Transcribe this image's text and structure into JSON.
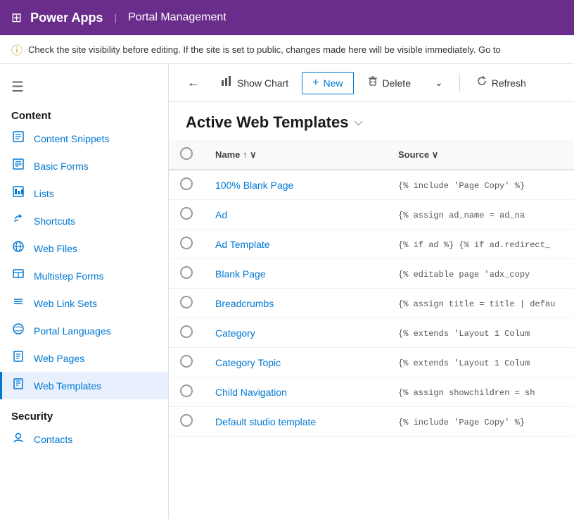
{
  "header": {
    "app_title": "Power Apps",
    "portal_title": "Portal Management",
    "grid_icon": "⊞"
  },
  "warning": {
    "text": "Check the site visibility before editing. If the site is set to public, changes made here will be visible immediately. Go to"
  },
  "toolbar": {
    "back_icon": "←",
    "show_chart_label": "Show Chart",
    "new_label": "New",
    "delete_label": "Delete",
    "refresh_label": "Refresh"
  },
  "page": {
    "title": "Active Web Templates",
    "title_chevron": "⌵"
  },
  "table": {
    "columns": [
      {
        "id": "select",
        "label": ""
      },
      {
        "id": "name",
        "label": "Name",
        "sort": "↑",
        "has_filter": true
      },
      {
        "id": "source",
        "label": "Source",
        "has_filter": true
      }
    ],
    "rows": [
      {
        "name": "100% Blank Page",
        "source": "{% include 'Page Copy' %}"
      },
      {
        "name": "Ad",
        "source": "{% assign ad_name = ad_na"
      },
      {
        "name": "Ad Template",
        "source": "{% if ad %} {% if ad.redirect_"
      },
      {
        "name": "Blank Page",
        "source": "{% editable page 'adx_copy"
      },
      {
        "name": "Breadcrumbs",
        "source": "{% assign title = title | defau"
      },
      {
        "name": "Category",
        "source": "{% extends 'Layout 1 Colum"
      },
      {
        "name": "Category Topic",
        "source": "{% extends 'Layout 1 Colum"
      },
      {
        "name": "Child Navigation",
        "source": "{% assign showchildren = sh"
      },
      {
        "name": "Default studio template",
        "source": "{% include 'Page Copy' %}"
      }
    ]
  },
  "sidebar": {
    "menu_icon": "☰",
    "content_section": "Content",
    "items": [
      {
        "id": "content-snippets",
        "label": "Content Snippets",
        "icon": "📄"
      },
      {
        "id": "basic-forms",
        "label": "Basic Forms",
        "icon": "📋"
      },
      {
        "id": "lists",
        "label": "Lists",
        "icon": "📊"
      },
      {
        "id": "shortcuts",
        "label": "Shortcuts",
        "icon": "↩"
      },
      {
        "id": "web-files",
        "label": "Web Files",
        "icon": "🌐"
      },
      {
        "id": "multistep-forms",
        "label": "Multistep Forms",
        "icon": "📝"
      },
      {
        "id": "web-link-sets",
        "label": "Web Link Sets",
        "icon": "🔗"
      },
      {
        "id": "portal-languages",
        "label": "Portal Languages",
        "icon": "🌍"
      },
      {
        "id": "web-pages",
        "label": "Web Pages",
        "icon": "📄"
      },
      {
        "id": "web-templates",
        "label": "Web Templates",
        "icon": "📄"
      }
    ],
    "security_section": "Security",
    "security_items": [
      {
        "id": "contacts",
        "label": "Contacts",
        "icon": "👤"
      }
    ]
  }
}
